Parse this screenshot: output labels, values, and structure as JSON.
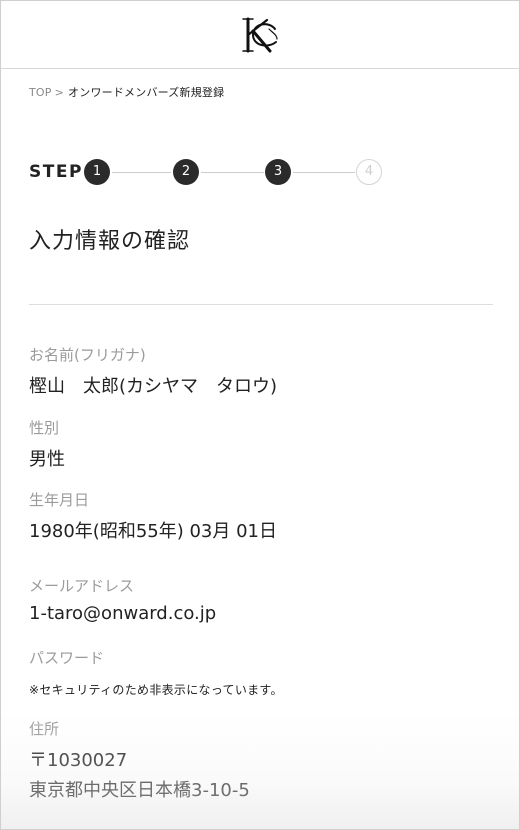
{
  "breadcrumb": {
    "top": "TOP",
    "separator": ">",
    "current": "オンワードメンバーズ新規登録"
  },
  "steps": {
    "label": "STEP",
    "items": [
      "1",
      "2",
      "3",
      "4"
    ],
    "current": 3
  },
  "page_title": "入力情報の確認",
  "fields": {
    "name": {
      "label": "お名前(フリガナ)",
      "value": "樫山　太郎(カシヤマ　タロウ)"
    },
    "gender": {
      "label": "性別",
      "value": "男性"
    },
    "birthday": {
      "label": "生年月日",
      "value": "1980年(昭和55年) 03月 01日"
    },
    "email": {
      "label": "メールアドレス",
      "value": "1-taro@onward.co.jp"
    },
    "password": {
      "label": "パスワード",
      "value": "※セキュリティのため非表示になっています。"
    },
    "address": {
      "label": "住所",
      "postal": "〒1030027",
      "line1": "東京都中央区日本橋3-10-5"
    }
  },
  "colors": {
    "text": "#222222",
    "label": "#9b9b9b",
    "step_active": "#2b2b2b",
    "step_inactive": "#d4d4d4",
    "divider": "#dddddd"
  }
}
